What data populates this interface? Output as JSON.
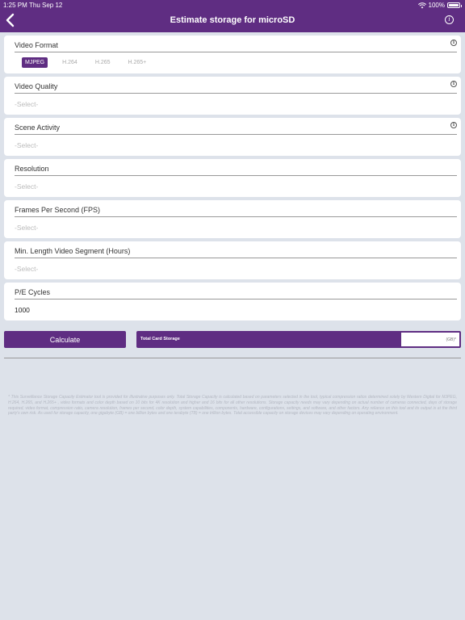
{
  "status": {
    "time": "1:25 PM",
    "date": "Thu Sep 12",
    "battery": "100%"
  },
  "nav": {
    "title": "Estimate storage for microSD",
    "info": "i"
  },
  "video_format": {
    "label": "Video Format",
    "options": [
      "MJPEG",
      "H.264",
      "H.265",
      "H.265+"
    ],
    "selected": "MJPEG"
  },
  "video_quality": {
    "label": "Video Quality",
    "placeholder": "-Select-"
  },
  "scene_activity": {
    "label": "Scene Activity",
    "placeholder": "-Select-"
  },
  "resolution": {
    "label": "Resolution",
    "placeholder": "-Select-"
  },
  "fps": {
    "label": "Frames Per Second (FPS)",
    "placeholder": "-Select-"
  },
  "segment": {
    "label": "Min. Length Video Segment (Hours)",
    "placeholder": "-Select-"
  },
  "pe_cycles": {
    "label": "P/E Cycles",
    "value": "1000"
  },
  "calculate": {
    "label": "Calculate"
  },
  "total": {
    "label": "Total Card Storage",
    "unit": "(GB)*"
  },
  "info_glyph": "i",
  "disclaimer": "* This Surveillance Storage Capacity Estimator tool is provided for illustrative purposes only. Total Storage Capacity is calculated based on parameters selected in the tool, typical compression ratios determined solely by Western Digital for MJPEG, H.264, H.265, and H.265+ , video formats and color depth based on 10 bits for 4K resolution and higher and 16 bits for all other resolutions. Storage capacity needs may vary depending on actual number of cameras connected, days of storage required, video format, compression ratio, camera resolution, frames per second, color depth, system capabilities, components, hardware, configurations, settings, and software, and other factors. Any reliance on this tool and its output is at the third party's own risk. As used for storage capacity, one gigabyte (GB) = one billion bytes and one terabyte (TB) = one trillion bytes. Total accessible capacity on storage devices may vary depending on operating environment."
}
